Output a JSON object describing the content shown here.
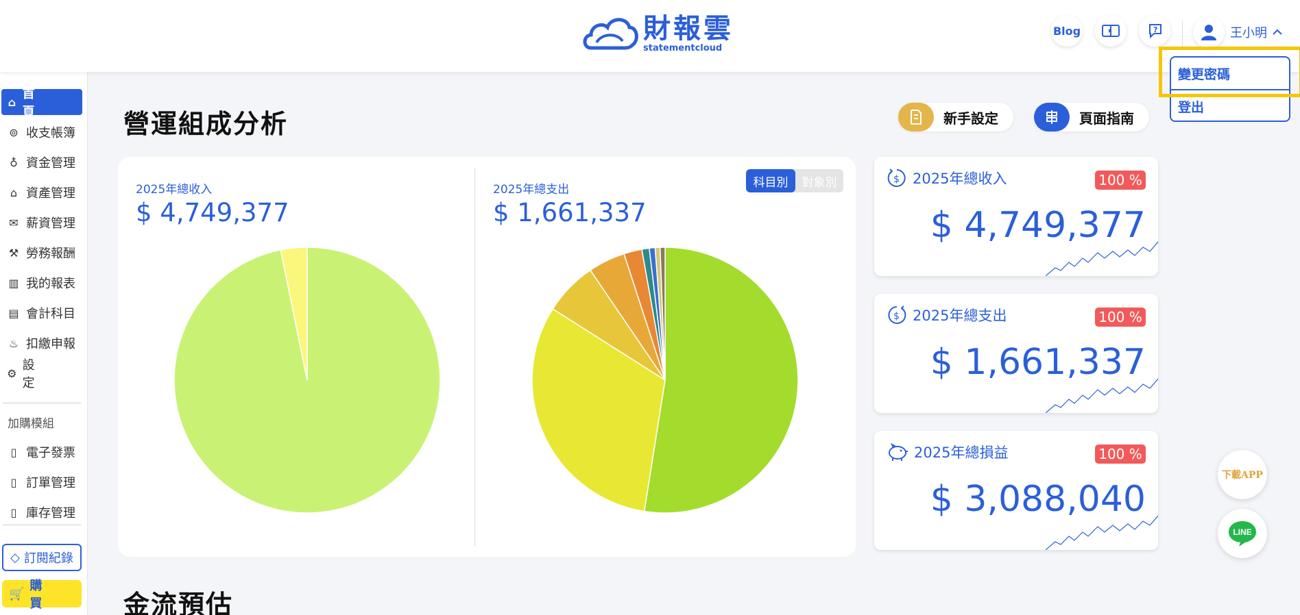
{
  "header": {
    "logo_zh": "財報雲",
    "logo_en": "statementcloud",
    "blog_label": "Blog",
    "user_name": "王小明"
  },
  "dropdown": {
    "items": [
      "變更密碼",
      "登出"
    ]
  },
  "sidebar": {
    "items": [
      {
        "label": "首　頁",
        "icon": "home-icon",
        "active": true
      },
      {
        "label": "收支帳簿",
        "icon": "coin-icon"
      },
      {
        "label": "資金管理",
        "icon": "fund-icon"
      },
      {
        "label": "資產管理",
        "icon": "asset-icon"
      },
      {
        "label": "薪資管理",
        "icon": "salary-icon"
      },
      {
        "label": "勞務報酬",
        "icon": "labor-icon"
      },
      {
        "label": "我的報表",
        "icon": "report-chart-icon"
      },
      {
        "label": "會計科目",
        "icon": "ledger-icon"
      },
      {
        "label": "扣繳申報",
        "icon": "withholding-icon"
      },
      {
        "label": "設　定",
        "icon": "settings-icon"
      }
    ],
    "addon_title": "加購模組",
    "addons": [
      {
        "label": "電子發票",
        "icon": "invoice-icon"
      },
      {
        "label": "訂單管理",
        "icon": "order-icon"
      },
      {
        "label": "庫存管理",
        "icon": "inventory-icon"
      }
    ],
    "subscription_label": "訂閱紀錄",
    "buy_label": "購　買"
  },
  "main": {
    "section_title": "營運組成分析",
    "setup_label": "新手設定",
    "guide_label": "頁面指南",
    "income_label": "2025年總收入",
    "income_value": "$ 4,749,377",
    "expense_label": "2025年總支出",
    "expense_value": "$ 1,661,337",
    "toggle_on": "科目別",
    "toggle_off": "對象別",
    "next_section_title": "金流預估"
  },
  "stats": [
    {
      "label": "2025年總收入",
      "badge": "100 %",
      "value": "$ 4,749,377",
      "icon": "income-cycle-icon"
    },
    {
      "label": "2025年總支出",
      "badge": "100 %",
      "value": "$ 1,661,337",
      "icon": "expense-cycle-icon"
    },
    {
      "label": "2025年總損益",
      "badge": "100 %",
      "value": "$ 3,088,040",
      "icon": "piggy-bank-icon"
    }
  ],
  "floating": {
    "download_app": "下載APP",
    "line": "LINE"
  },
  "colors": {
    "primary": "#2b5fd9",
    "badge": "#f25a5a",
    "buy": "#fde428",
    "highlight": "#f7c600"
  },
  "chart_data": [
    {
      "type": "pie",
      "title": "2025年總收入",
      "slices": [
        {
          "color": "#c9f274",
          "value": 96.8
        },
        {
          "color": "#fbf77c",
          "value": 3.2
        }
      ]
    },
    {
      "type": "pie",
      "title": "2025年總支出",
      "slices": [
        {
          "color": "#a3dc2d",
          "value": 52.5
        },
        {
          "color": "#e8e834",
          "value": 31.5
        },
        {
          "color": "#e8c63a",
          "value": 6.5
        },
        {
          "color": "#e8a838",
          "value": 4.5
        },
        {
          "color": "#e88834",
          "value": 2.2
        },
        {
          "color": "#2e8a8a",
          "value": 0.9
        },
        {
          "color": "#3a6fd0",
          "value": 0.7
        },
        {
          "color": "#d4c87a",
          "value": 0.6
        },
        {
          "color": "#8a7a5a",
          "value": 0.6
        }
      ]
    }
  ]
}
